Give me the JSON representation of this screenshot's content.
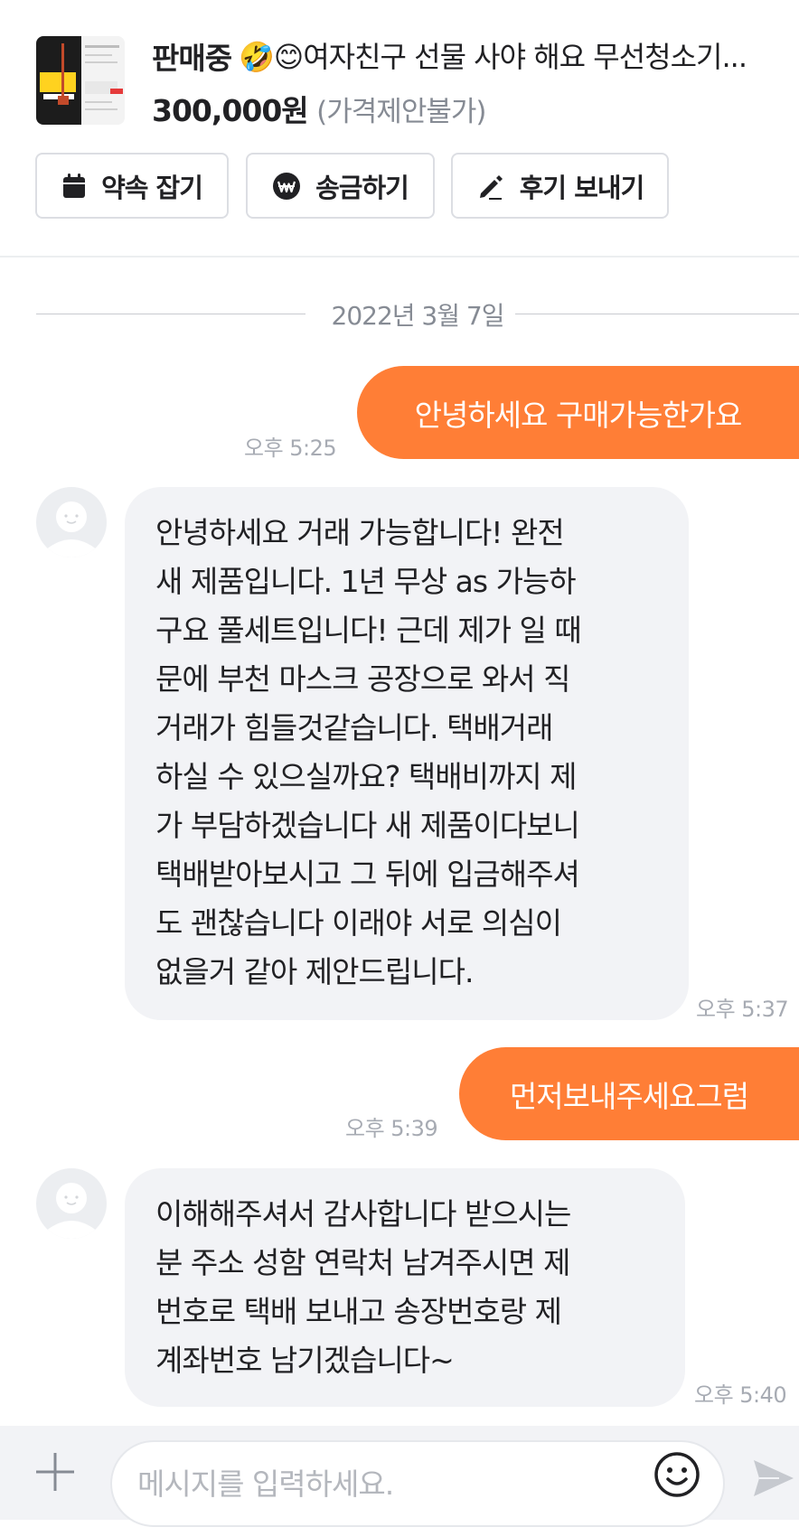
{
  "header": {
    "status": "판매중",
    "title": "🤣😊여자친구 선물 사야 해요 무선청소기...",
    "price": "300,000원",
    "price_note": "(가격제안불가)",
    "actions": [
      {
        "label": "약속 잡기",
        "icon": "calendar-icon"
      },
      {
        "label": "송금하기",
        "icon": "won-pay-icon"
      },
      {
        "label": "후기 보내기",
        "icon": "pencil-icon"
      }
    ]
  },
  "chat": {
    "date": "2022년 3월 7일",
    "messages": [
      {
        "side": "me",
        "text": "안녕하세요 구매가능한가요",
        "time": "오후 5:25"
      },
      {
        "side": "them",
        "lines": [
          "안녕하세요 거래 가능합니다! 완전",
          "새 제품입니다. 1년 무상 as 가능하",
          "구요 풀세트입니다! 근데 제가 일 때",
          "문에 부천 마스크 공장으로 와서 직",
          "거래가 힘들것같습니다.  택배거래",
          "하실 수 있으실까요? 택배비까지 제",
          "가 부담하겠습니다 새 제품이다보니",
          "택배받아보시고 그 뒤에 입금해주셔",
          "도 괜찮습니다 이래야 서로 의심이",
          "없을거 같아 제안드립니다."
        ],
        "time": "오후 5:37"
      },
      {
        "side": "me",
        "text": "먼저보내주세요그럼",
        "time": "오후 5:39"
      },
      {
        "side": "them",
        "lines": [
          "이해해주셔서 감사합니다 받으시는",
          "분 주소 성함 연락처 남겨주시면 제",
          "번호로 택배 보내고 송장번호랑 제",
          "계좌번호 남기겠습니다~"
        ],
        "time": "오후 5:40"
      }
    ]
  },
  "composer": {
    "placeholder": "메시지를 입력하세요.",
    "value": ""
  },
  "colors": {
    "accent": "#ff7e36",
    "incoming_bubble": "#f2f3f6",
    "muted_text": "#868b94"
  }
}
